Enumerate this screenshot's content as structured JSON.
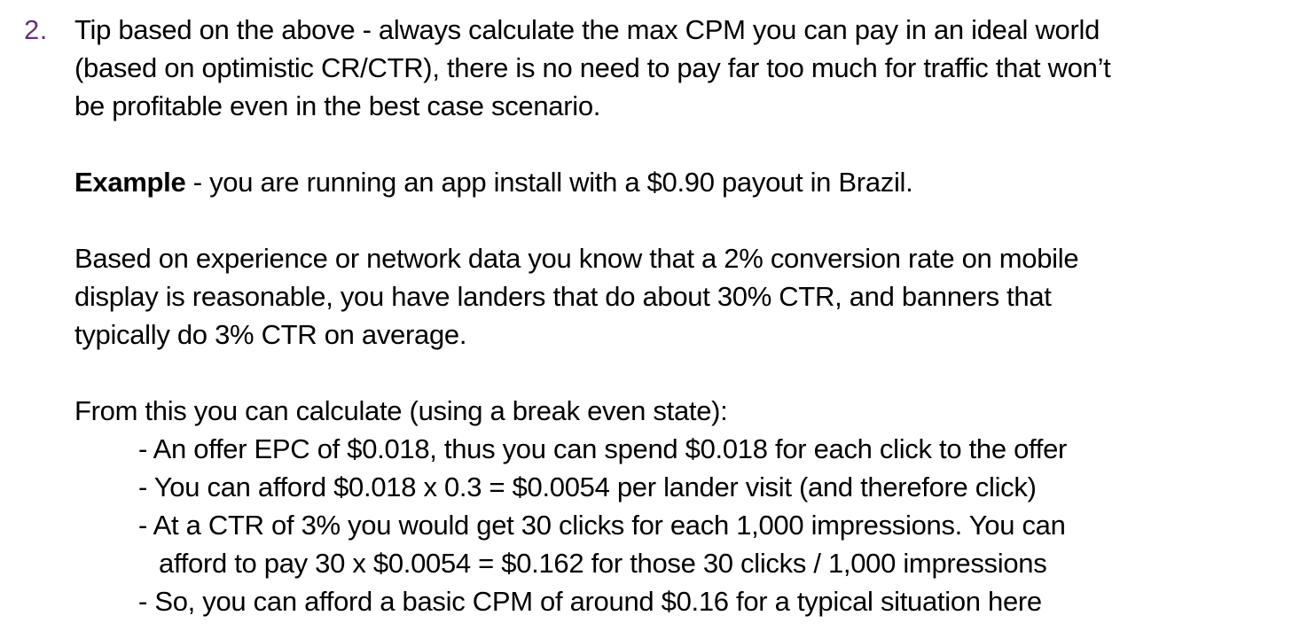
{
  "list_item": {
    "number": "2.",
    "tip_lines": [
      "Tip based on the above - always calculate the max CPM you can pay in an ideal world",
      "(based on optimistic CR/CTR), there is no need to pay far too much for traffic that won’t",
      "be profitable even in the best case scenario."
    ],
    "example": {
      "label": "Example",
      "text": " - you are running an app install with a $0.90 payout in Brazil."
    },
    "assumption_lines": [
      "Based on experience or network data you know that a 2% conversion rate on mobile",
      "display is reasonable, you have landers that do about 30% CTR, and banners that",
      "typically do 3% CTR on average."
    ],
    "calc_intro": "From this you can calculate (using a break even state):",
    "bullets": [
      "- An offer EPC of $0.018, thus you can spend $0.018 for each click to the offer",
      "- You can afford $0.018 x 0.3 = $0.0054 per lander visit (and therefore click)",
      "- At a CTR of 3% you would get 30 clicks for each 1,000 impressions. You can",
      "afford to pay 30 x $0.0054 =  $0.162 for those 30 clicks / 1,000 impressions",
      "- So, you can afford a basic CPM of around $0.16 for a typical situation here"
    ]
  },
  "colors": {
    "list_number": "#6b2f7c",
    "text": "#000000",
    "background": "#ffffff"
  }
}
